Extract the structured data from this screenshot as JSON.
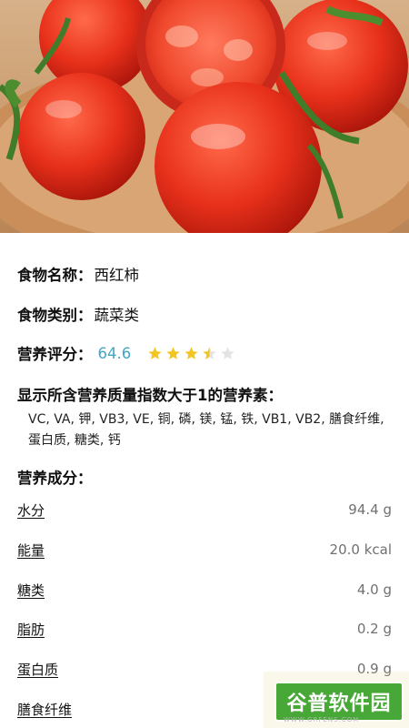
{
  "food": {
    "name_label": "食物名称：",
    "name": "西红柿",
    "category_label": "食物类别：",
    "category": "蔬菜类",
    "score_label": "营养评分：",
    "score": "64.6",
    "rating_stars": 3.5,
    "rating_max": 5
  },
  "nutrients_high_quality": {
    "heading": "显示所含营养质量指数大于1的营养素：",
    "list": "VC, VA, 钾, VB3, VE, 铜, 磷, 镁, 锰, 铁, VB1, VB2, 膳食纤维, 蛋白质, 糖类, 钙"
  },
  "composition": {
    "heading": "营养成分：",
    "rows": [
      {
        "name": "水分",
        "value": "94.4 g"
      },
      {
        "name": "能量",
        "value": "20.0 kcal"
      },
      {
        "name": "糖类",
        "value": "4.0 g"
      },
      {
        "name": "脂肪",
        "value": "0.2 g"
      },
      {
        "name": "蛋白质",
        "value": "0.9 g"
      },
      {
        "name": "膳食纤维",
        "value": ""
      }
    ]
  },
  "watermark": {
    "text": "谷普软件园",
    "sub": "WWW.GRFENS.COM"
  },
  "colors": {
    "score": "#43a7c4",
    "star_filled": "#f4c51f",
    "star_empty": "#e3e3e3",
    "watermark": "#47a837"
  }
}
